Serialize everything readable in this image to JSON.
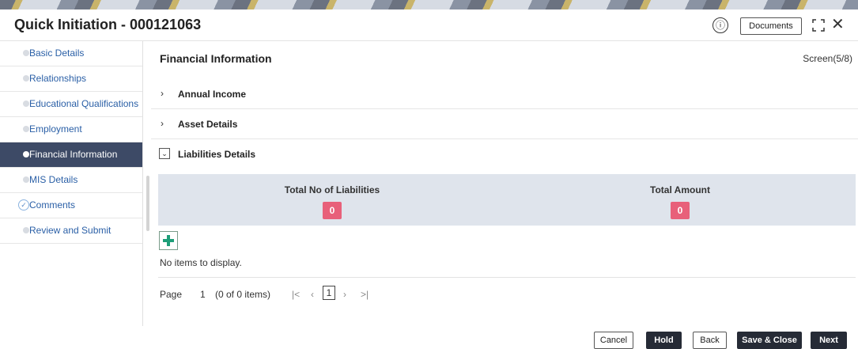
{
  "header": {
    "title": "Quick Initiation - 000121063",
    "documents_label": "Documents",
    "info_glyph": "ⓘ",
    "close_glyph": "✕"
  },
  "sidebar": {
    "items": [
      {
        "label": "Basic Details",
        "state": "default"
      },
      {
        "label": "Relationships",
        "state": "default"
      },
      {
        "label": "Educational Qualifications",
        "state": "default"
      },
      {
        "label": "Employment",
        "state": "default"
      },
      {
        "label": "Financial Information",
        "state": "active"
      },
      {
        "label": "MIS Details",
        "state": "default"
      },
      {
        "label": "Comments",
        "state": "completed"
      },
      {
        "label": "Review and Submit",
        "state": "default"
      }
    ]
  },
  "main": {
    "section_title": "Financial Information",
    "screen_label": "Screen(5/8)",
    "accordions": [
      {
        "label": "Annual Income",
        "expanded": false,
        "glyph": "›"
      },
      {
        "label": "Asset Details",
        "expanded": false,
        "glyph": "›"
      },
      {
        "label": "Liabilities Details",
        "expanded": true,
        "glyph": "⌄"
      }
    ],
    "summary": {
      "total_no_label": "Total No of Liabilities",
      "total_no_value": "0",
      "total_amount_label": "Total Amount",
      "total_amount_value": "0"
    },
    "empty_message": "No items to display.",
    "pager": {
      "page_label": "Page",
      "page_number": "1",
      "items_info": "(0 of 0 items)",
      "first_glyph": "|<",
      "prev_glyph": "‹",
      "current_page": "1",
      "next_glyph": "›",
      "last_glyph": ">|"
    }
  },
  "footer": {
    "cancel": "Cancel",
    "hold": "Hold",
    "back": "Back",
    "save_close": "Save & Close",
    "next": "Next"
  },
  "colors": {
    "active_nav": "#3d4a66",
    "link_blue": "#2a5fa6",
    "badge_pink": "#e8607a",
    "summary_bg": "#dfe4ec",
    "add_green": "#1e9e78",
    "dark_button": "#262b36"
  }
}
